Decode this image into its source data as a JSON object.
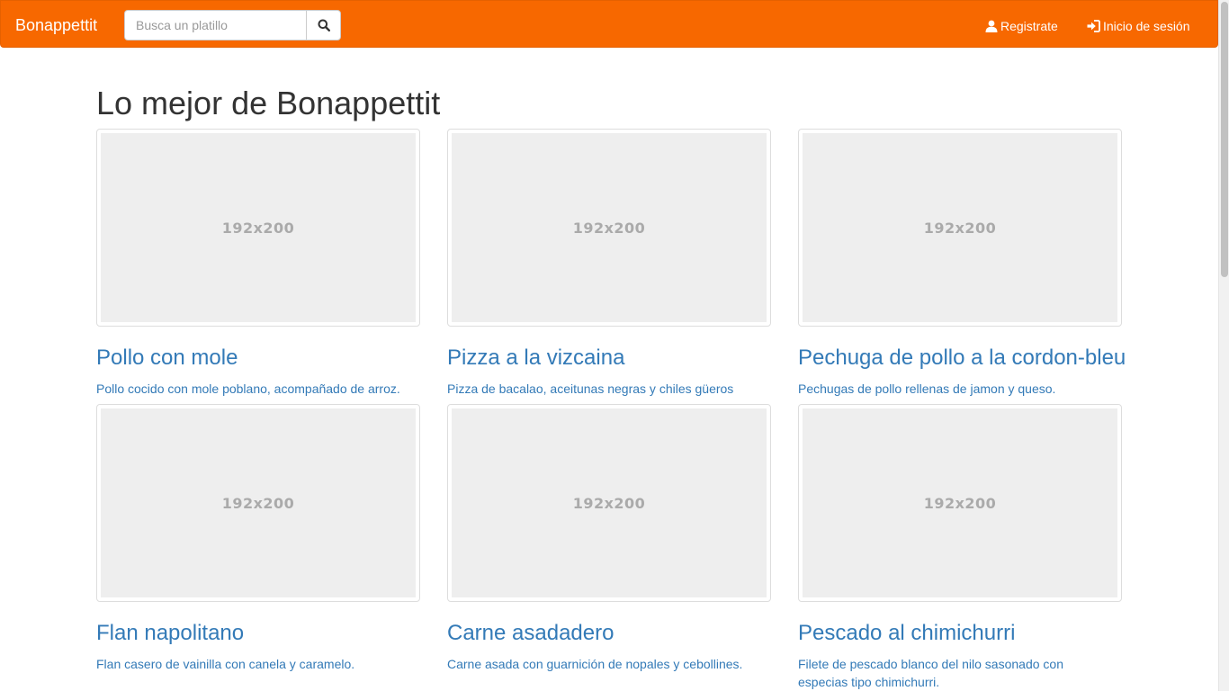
{
  "navbar": {
    "brand": "Bonappettit",
    "search_placeholder": "Busca un platillo",
    "search_value": "",
    "register_label": "Registrate",
    "login_label": "Inicio de sesión",
    "background_color": "#f76800"
  },
  "main": {
    "title": "Lo mejor de Bonappettit",
    "placeholder_text": "192x200",
    "link_color": "#337ab7",
    "dishes": [
      {
        "name": "Pollo con mole",
        "description": "Pollo cocido con mole poblano, acompañado de arroz."
      },
      {
        "name": "Pizza a la vizcaina",
        "description": "Pizza de bacalao, aceitunas negras y chiles güeros"
      },
      {
        "name": "Pechuga de pollo a la cordon-bleu",
        "description": "Pechugas de pollo rellenas de jamon y queso."
      },
      {
        "name": "Flan napolitano",
        "description": "Flan casero de vainilla con canela y caramelo."
      },
      {
        "name": "Carne asadadero",
        "description": "Carne asada con guarnición de nopales y cebollines."
      },
      {
        "name": "Pescado al chimichurri",
        "description": "Filete de pescado blanco del nilo sasonado con especias tipo chimichurri."
      }
    ]
  },
  "icons": {
    "search": "search-icon",
    "register": "user-icon",
    "login": "sign-in-icon"
  }
}
